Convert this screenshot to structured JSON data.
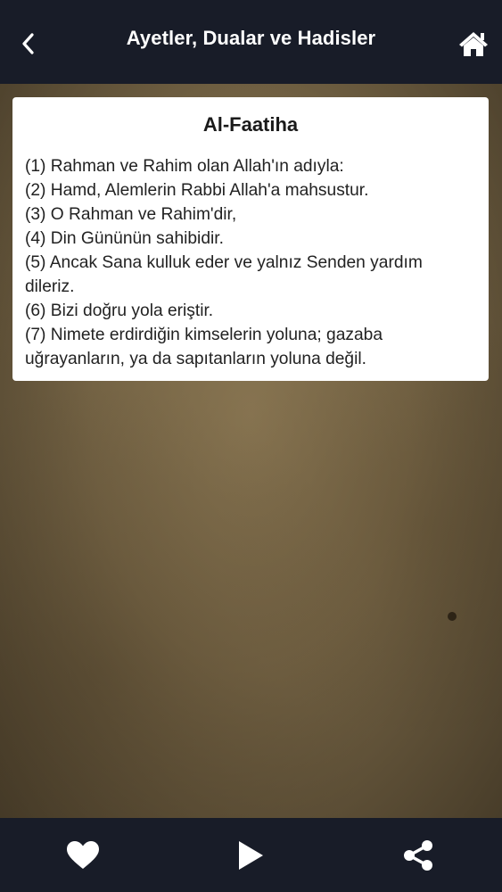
{
  "header": {
    "title": "Ayetler, Dualar ve Hadisler",
    "back_icon": "chevron-left-icon",
    "home_icon": "home-icon"
  },
  "card": {
    "title": "Al-Faatiha",
    "verses": [
      "(1) Rahman ve Rahim olan Allah'ın adıyla:",
      "(2) Hamd, Alemlerin Rabbi Allah'a mahsustur.",
      "(3) O Rahman ve Rahim'dir,",
      "(4) Din Gününün sahibidir.",
      "(5) Ancak Sana kulluk eder ve yalnız Senden yardım dileriz.",
      "(6) Bizi doğru yola eriştir.",
      "(7) Nimete erdirdiğin kimselerin yoluna; gazaba uğrayanların, ya da sapıtanların yoluna değil."
    ]
  },
  "tabbar": {
    "favorite_icon": "heart-icon",
    "play_icon": "play-icon",
    "share_icon": "share-icon"
  },
  "colors": {
    "bar_background": "#181c28",
    "icon": "#ffffff",
    "card_background": "#ffffff",
    "parchment": "#6e5f43"
  }
}
